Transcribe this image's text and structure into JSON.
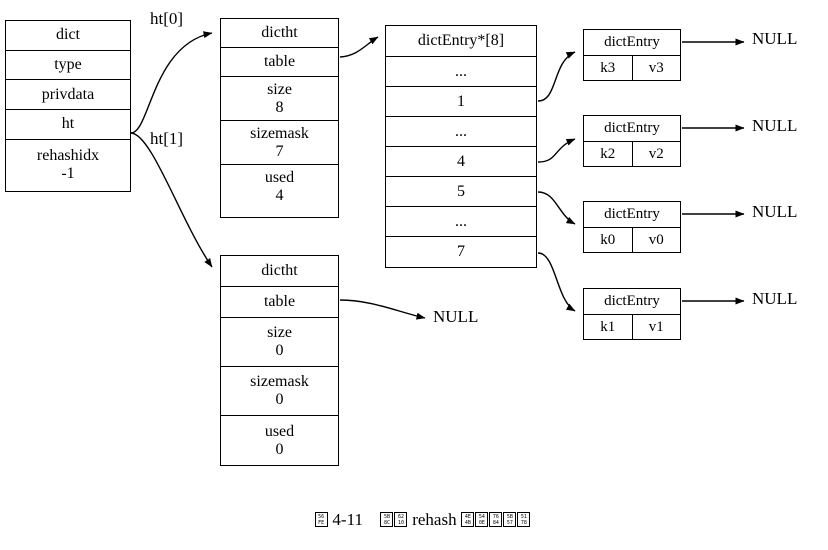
{
  "diagram": {
    "title_caption": {
      "figure_number": "图 4-11",
      "text": "完成 rehash 之后的字典",
      "plain": "图 4-11　完成 rehash 之后的字典",
      "tofu_codes_prefix": [
        "56FE"
      ],
      "tofu_codes_suffix": [
        "5B8C",
        "6210"
      ],
      "latin_middle": "rehash",
      "tofu_codes_tail": [
        "4E4B",
        "540E",
        "7684",
        "5B57",
        "5178"
      ],
      "figure_label": "4-11"
    },
    "dict_struct": {
      "name": "dict",
      "fields": [
        {
          "label": "type",
          "value": ""
        },
        {
          "label": "privdata",
          "value": ""
        },
        {
          "label": "ht",
          "value": ""
        },
        {
          "label": "rehashidx",
          "value": "-1"
        }
      ]
    },
    "pointer_labels": {
      "ht0": "ht[0]",
      "ht1": "ht[1]"
    },
    "dictht_0": {
      "name": "dictht",
      "table_label": "table",
      "fields": [
        {
          "label": "size",
          "value": "8"
        },
        {
          "label": "sizemask",
          "value": "7"
        },
        {
          "label": "used",
          "value": "4"
        }
      ]
    },
    "dictht_1": {
      "name": "dictht",
      "table_label": "table",
      "fields": [
        {
          "label": "size",
          "value": "0"
        },
        {
          "label": "sizemask",
          "value": "0"
        },
        {
          "label": "used",
          "value": "0"
        }
      ],
      "table_target": "NULL"
    },
    "bucket_array": {
      "header": "dictEntry*[8]",
      "rows": [
        "...",
        "1",
        "...",
        "4",
        "5",
        "...",
        "7"
      ]
    },
    "entries": [
      {
        "title": "dictEntry",
        "key": "k3",
        "value": "v3",
        "next": "NULL"
      },
      {
        "title": "dictEntry",
        "key": "k2",
        "value": "v2",
        "next": "NULL"
      },
      {
        "title": "dictEntry",
        "key": "k0",
        "value": "v0",
        "next": "NULL"
      },
      {
        "title": "dictEntry",
        "key": "k1",
        "value": "v1",
        "next": "NULL"
      }
    ],
    "colors": {
      "stroke": "#000000",
      "background": "#ffffff",
      "text": "#000000"
    }
  }
}
